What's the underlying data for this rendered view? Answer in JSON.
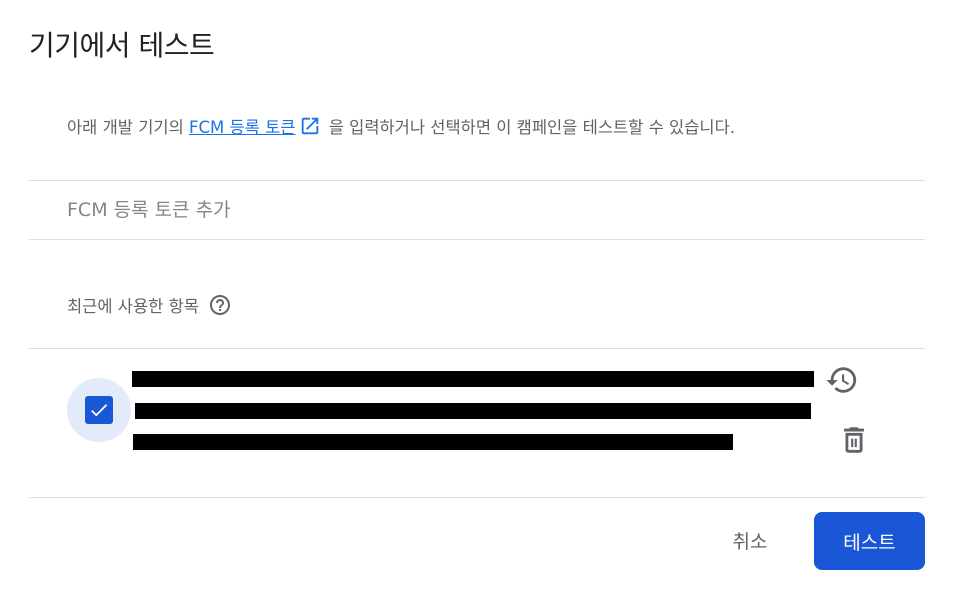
{
  "dialog": {
    "title": "기기에서 테스트",
    "description_before": "아래 개발 기기의 ",
    "description_link": "FCM 등록 토큰",
    "description_after": " 을 입력하거나 선택하면 이 캠페인을 테스트할 수 있습니다.",
    "token_input": {
      "placeholder": "FCM 등록 토큰 추가",
      "value": ""
    },
    "recent": {
      "label": "최근에 사용한 항목",
      "items": [
        {
          "checked": true,
          "token_redacted": true
        }
      ]
    },
    "buttons": {
      "cancel": "취소",
      "test": "테스트"
    }
  },
  "colors": {
    "primary": "#1a57d6",
    "link": "#1a73e8",
    "check_bg": "#e3ebfa"
  },
  "icons": {
    "external_link": "open-in-new-icon",
    "help": "help-circle-icon",
    "history": "history-icon",
    "delete": "trash-icon",
    "check": "check-icon"
  }
}
